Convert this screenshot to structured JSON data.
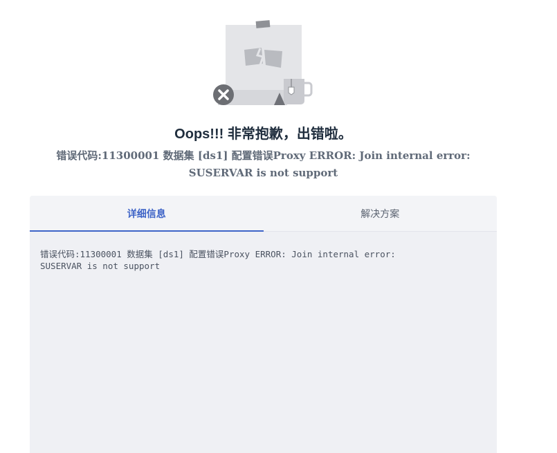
{
  "header": {
    "title": "Oops!!! 非常抱歉，出错啦。",
    "error_message": "错误代码:11300001 数据集 [ds1] 配置错误Proxy ERROR: Join internal error: SUSERVAR is not support"
  },
  "tabs": [
    {
      "label": "详细信息",
      "active": true
    },
    {
      "label": "解决方案",
      "active": false
    }
  ],
  "detail": {
    "text": "错误代码:11300001 数据集 [ds1] 配置错误Proxy ERROR: Join internal error:\nSUSERVAR is not support"
  },
  "colors": {
    "accent": "#3d63c7",
    "panel_bg": "#eff0f4",
    "title": "#1f2d3d"
  },
  "icons": {
    "error_badge": "close-icon",
    "illustration": "broken-page-with-cup"
  }
}
